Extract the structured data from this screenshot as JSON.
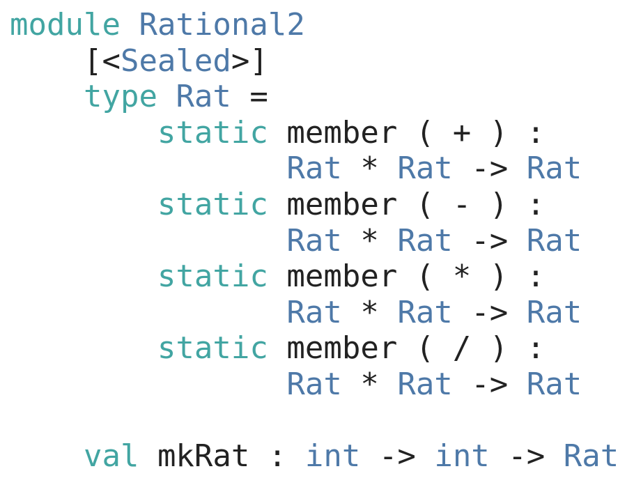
{
  "code_lines": [
    [
      {
        "t": "module",
        "k": "keyword"
      },
      {
        "t": " ",
        "k": "plain"
      },
      {
        "t": "Rational2",
        "k": "type"
      }
    ],
    [
      {
        "t": "    [<",
        "k": "plain"
      },
      {
        "t": "Sealed",
        "k": "type"
      },
      {
        "t": ">]",
        "k": "plain"
      }
    ],
    [
      {
        "t": "    ",
        "k": "plain"
      },
      {
        "t": "type",
        "k": "keyword"
      },
      {
        "t": " ",
        "k": "plain"
      },
      {
        "t": "Rat",
        "k": "type"
      },
      {
        "t": " =",
        "k": "plain"
      }
    ],
    [
      {
        "t": "        ",
        "k": "plain"
      },
      {
        "t": "static",
        "k": "keyword"
      },
      {
        "t": " member ( + ) :",
        "k": "plain"
      }
    ],
    [
      {
        "t": "               ",
        "k": "plain"
      },
      {
        "t": "Rat",
        "k": "type"
      },
      {
        "t": " * ",
        "k": "plain"
      },
      {
        "t": "Rat",
        "k": "type"
      },
      {
        "t": " -> ",
        "k": "plain"
      },
      {
        "t": "Rat",
        "k": "type"
      }
    ],
    [
      {
        "t": "        ",
        "k": "plain"
      },
      {
        "t": "static",
        "k": "keyword"
      },
      {
        "t": " member ( - ) :",
        "k": "plain"
      }
    ],
    [
      {
        "t": "               ",
        "k": "plain"
      },
      {
        "t": "Rat",
        "k": "type"
      },
      {
        "t": " * ",
        "k": "plain"
      },
      {
        "t": "Rat",
        "k": "type"
      },
      {
        "t": " -> ",
        "k": "plain"
      },
      {
        "t": "Rat",
        "k": "type"
      }
    ],
    [
      {
        "t": "        ",
        "k": "plain"
      },
      {
        "t": "static",
        "k": "keyword"
      },
      {
        "t": " member ( * ) :",
        "k": "plain"
      }
    ],
    [
      {
        "t": "               ",
        "k": "plain"
      },
      {
        "t": "Rat",
        "k": "type"
      },
      {
        "t": " * ",
        "k": "plain"
      },
      {
        "t": "Rat",
        "k": "type"
      },
      {
        "t": " -> ",
        "k": "plain"
      },
      {
        "t": "Rat",
        "k": "type"
      }
    ],
    [
      {
        "t": "        ",
        "k": "plain"
      },
      {
        "t": "static",
        "k": "keyword"
      },
      {
        "t": " member ( / ) :",
        "k": "plain"
      }
    ],
    [
      {
        "t": "               ",
        "k": "plain"
      },
      {
        "t": "Rat",
        "k": "type"
      },
      {
        "t": " * ",
        "k": "plain"
      },
      {
        "t": "Rat",
        "k": "type"
      },
      {
        "t": " -> ",
        "k": "plain"
      },
      {
        "t": "Rat",
        "k": "type"
      }
    ],
    [],
    [
      {
        "t": "    ",
        "k": "plain"
      },
      {
        "t": "val",
        "k": "keyword"
      },
      {
        "t": " mkRat : ",
        "k": "plain"
      },
      {
        "t": "int",
        "k": "type"
      },
      {
        "t": " -> ",
        "k": "plain"
      },
      {
        "t": "int",
        "k": "type"
      },
      {
        "t": " -> ",
        "k": "plain"
      },
      {
        "t": "Rat",
        "k": "type"
      }
    ]
  ]
}
